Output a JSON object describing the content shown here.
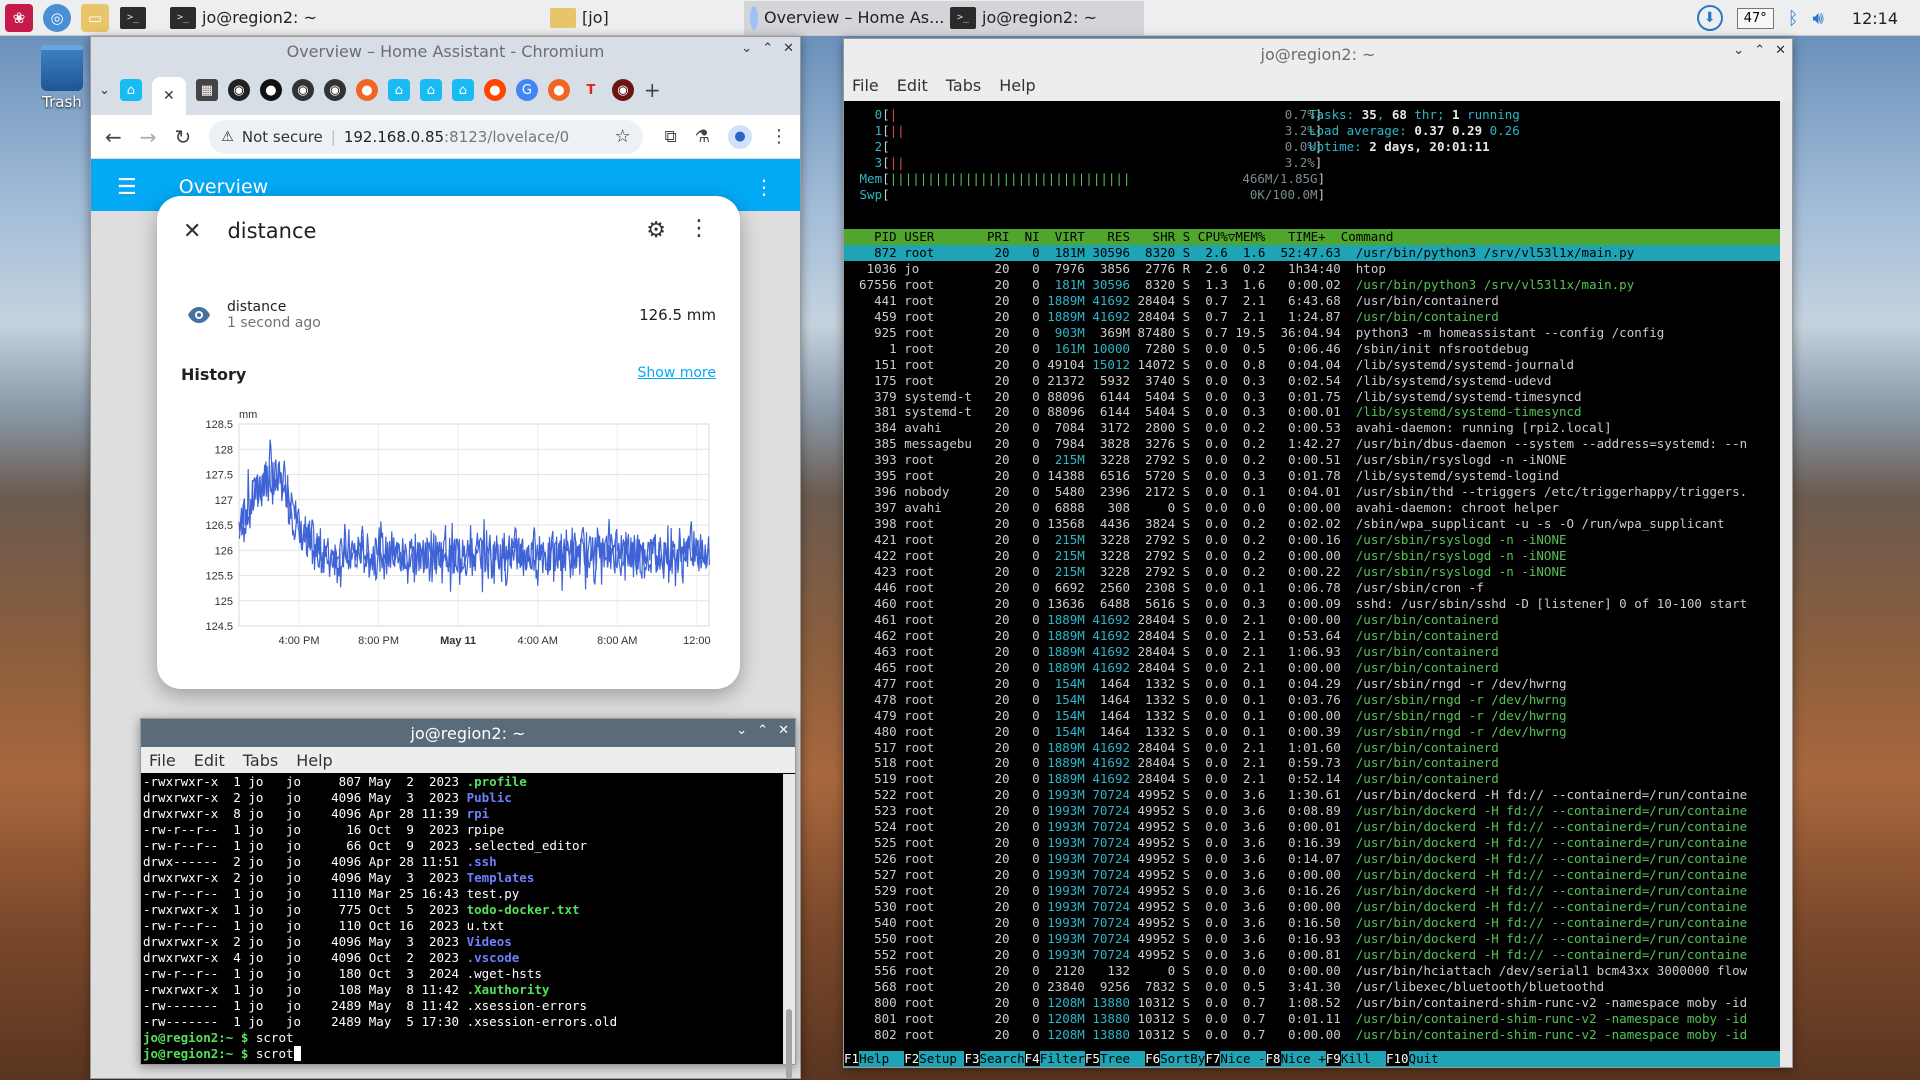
{
  "taskbar": {
    "windows": [
      {
        "label": "jo@region2: ~",
        "icon": "terminal-icon"
      },
      {
        "label": "[jo]",
        "icon": "folder-icon"
      },
      {
        "label": "Overview – Home As...",
        "icon": "chromium-icon"
      },
      {
        "label": "jo@region2: ~",
        "icon": "terminal-icon"
      }
    ],
    "temperature": "47°",
    "clock": "12:14"
  },
  "desktop": {
    "trash_label": "Trash"
  },
  "chromium": {
    "title": "Overview – Home Assistant - Chromium",
    "url_host": "192.168.0.85",
    "url_path": ":8123/lovelace/0",
    "not_secure": "Not secure"
  },
  "ha": {
    "header_title": "Overview",
    "dialog": {
      "title": "distance",
      "entity_name": "distance",
      "entity_updated": "1 second ago",
      "entity_state": "126.5 mm",
      "history_label": "History",
      "show_more": "Show more"
    }
  },
  "chart_data": {
    "type": "line",
    "title": "",
    "ylabel": "mm",
    "ylim": [
      124.5,
      128.5
    ],
    "yticks": [
      "128.5",
      "128",
      "127.5",
      "127",
      "126.5",
      "126",
      "125.5",
      "125",
      "124.5"
    ],
    "xticks": [
      "4:00 PM",
      "8:00 PM",
      "May 11",
      "4:00 AM",
      "8:00 AM",
      "12:00"
    ],
    "xtick_bold": "May 11",
    "series": [
      {
        "color": "#3f63d6",
        "values": [
          126.5,
          127.1,
          127.5,
          127.3,
          126.4,
          126.0,
          125.9,
          125.9,
          125.95,
          125.9,
          125.92,
          125.88,
          125.9,
          125.95,
          125.9,
          125.88,
          125.9,
          125.92,
          125.9,
          125.94,
          125.9,
          125.92,
          125.9,
          125.95,
          125.95,
          126.0,
          125.95,
          125.9,
          125.95,
          125.9,
          126.0,
          125.95
        ]
      }
    ]
  },
  "terminal_small": {
    "title": "jo@region2: ~",
    "menu": [
      "File",
      "Edit",
      "Tabs",
      "Help"
    ],
    "lines": [
      {
        "perm": "-rwxrwxr-x",
        "n": "1",
        "u": "jo",
        "g": "jo",
        "size": "807",
        "date": "May  2  2023",
        "name": ".profile",
        "style": "grn"
      },
      {
        "perm": "drwxrwxr-x",
        "n": "2",
        "u": "jo",
        "g": "jo",
        "size": "4096",
        "date": "May  3  2023",
        "name": "Public",
        "style": "blu"
      },
      {
        "perm": "drwxrwxr-x",
        "n": "8",
        "u": "jo",
        "g": "jo",
        "size": "4096",
        "date": "Apr 28 11:39",
        "name": "rpi",
        "style": "blu"
      },
      {
        "perm": "-rw-r--r--",
        "n": "1",
        "u": "jo",
        "g": "jo",
        "size": "16",
        "date": "Oct  9  2023",
        "name": "rpipe",
        "style": ""
      },
      {
        "perm": "-rw-r--r--",
        "n": "1",
        "u": "jo",
        "g": "jo",
        "size": "66",
        "date": "Oct  9  2023",
        "name": ".selected_editor",
        "style": ""
      },
      {
        "perm": "drwx------",
        "n": "2",
        "u": "jo",
        "g": "jo",
        "size": "4096",
        "date": "Apr 28 11:51",
        "name": ".ssh",
        "style": "blu"
      },
      {
        "perm": "drwxrwxr-x",
        "n": "2",
        "u": "jo",
        "g": "jo",
        "size": "4096",
        "date": "May  3  2023",
        "name": "Templates",
        "style": "blu"
      },
      {
        "perm": "-rw-r--r--",
        "n": "1",
        "u": "jo",
        "g": "jo",
        "size": "1110",
        "date": "Mar 25 16:43",
        "name": "test.py",
        "style": ""
      },
      {
        "perm": "-rwxrwxr-x",
        "n": "1",
        "u": "jo",
        "g": "jo",
        "size": "775",
        "date": "Oct  5  2023",
        "name": "todo-docker.txt",
        "style": "grn"
      },
      {
        "perm": "-rw-r--r--",
        "n": "1",
        "u": "jo",
        "g": "jo",
        "size": "110",
        "date": "Oct 16  2023",
        "name": "u.txt",
        "style": ""
      },
      {
        "perm": "drwxrwxr-x",
        "n": "2",
        "u": "jo",
        "g": "jo",
        "size": "4096",
        "date": "May  3  2023",
        "name": "Videos",
        "style": "blu"
      },
      {
        "perm": "drwxrwxr-x",
        "n": "4",
        "u": "jo",
        "g": "jo",
        "size": "4096",
        "date": "Oct  2  2023",
        "name": ".vscode",
        "style": "blu"
      },
      {
        "perm": "-rw-r--r--",
        "n": "1",
        "u": "jo",
        "g": "jo",
        "size": "180",
        "date": "Oct  3  2024",
        "name": ".wget-hsts",
        "style": ""
      },
      {
        "perm": "-rwxrwxr-x",
        "n": "1",
        "u": "jo",
        "g": "jo",
        "size": "108",
        "date": "May  8 11:42",
        "name": ".Xauthority",
        "style": "grn"
      },
      {
        "perm": "-rw-------",
        "n": "1",
        "u": "jo",
        "g": "jo",
        "size": "2489",
        "date": "May  8 11:42",
        "name": ".xsession-errors",
        "style": ""
      },
      {
        "perm": "-rw-------",
        "n": "1",
        "u": "jo",
        "g": "jo",
        "size": "2489",
        "date": "May  5 17:30",
        "name": ".xsession-errors.old",
        "style": ""
      }
    ],
    "prompt": "jo@region2:~ $",
    "cmd1": "scrot",
    "cmd2": "scrot"
  },
  "htop": {
    "title": "jo@region2: ~",
    "menu": [
      "File",
      "Edit",
      "Tabs",
      "Help"
    ],
    "cpu": [
      {
        "id": "0",
        "bar": "|",
        "pct": "0.7%"
      },
      {
        "id": "1",
        "bar": "||",
        "pct": "3.2%"
      },
      {
        "id": "2",
        "bar": "",
        "pct": "0.0%"
      },
      {
        "id": "3",
        "bar": "||",
        "pct": "3.2%"
      }
    ],
    "mem": {
      "bar": "||||||||||||||||||||||||||||||||",
      "val": "466M/1.85G"
    },
    "swp": {
      "val": "0K/100.0M"
    },
    "tasks": {
      "label": "Tasks:",
      "a": "35",
      "b": "68",
      "thr": "thr;",
      "c": "1",
      "running": "running"
    },
    "load": {
      "label": "Load average:",
      "a": "0.37",
      "b": "0.29",
      "c": "0.26"
    },
    "uptime": {
      "label": "Uptime:",
      "val": "2 days, 20:01:11"
    },
    "header": "    PID USER       PRI  NI  VIRT   RES   SHR S CPU%▽MEM%   TIME+  Command",
    "rows": [
      [
        "872",
        "root",
        "20",
        "0",
        "181M",
        "30596",
        "8320",
        "S",
        "2.6",
        "1.6",
        "52:47.63",
        "/usr/bin/python3 /srv/vl53l1x/main.py",
        "sel"
      ],
      [
        "1036",
        "jo",
        "20",
        "0",
        "7976",
        "3856",
        "2776",
        "R",
        "2.6",
        "0.2",
        "1h34:40",
        "htop",
        ""
      ],
      [
        "67556",
        "root",
        "20",
        "0",
        "181M",
        "30596",
        "8320",
        "S",
        "1.3",
        "1.6",
        "0:00.02",
        "/usr/bin/python3 /srv/vl53l1x/main.py",
        "g"
      ],
      [
        "441",
        "root",
        "20",
        "0",
        "1889M",
        "41692",
        "28404",
        "S",
        "0.7",
        "2.1",
        "6:43.68",
        "/usr/bin/containerd",
        ""
      ],
      [
        "459",
        "root",
        "20",
        "0",
        "1889M",
        "41692",
        "28404",
        "S",
        "0.7",
        "2.1",
        "1:24.87",
        "/usr/bin/containerd",
        "g"
      ],
      [
        "925",
        "root",
        "20",
        "0",
        "903M",
        "369M",
        "87480",
        "S",
        "0.7",
        "19.5",
        "36:04.94",
        "python3 -m homeassistant --config /config",
        ""
      ],
      [
        "1",
        "root",
        "20",
        "0",
        "161M",
        "10000",
        "7280",
        "S",
        "0.0",
        "0.5",
        "0:06.46",
        "/sbin/init nfsrootdebug",
        ""
      ],
      [
        "151",
        "root",
        "20",
        "0",
        "49104",
        "15012",
        "14072",
        "S",
        "0.0",
        "0.8",
        "0:04.04",
        "/lib/systemd/systemd-journald",
        ""
      ],
      [
        "175",
        "root",
        "20",
        "0",
        "21372",
        "5932",
        "3740",
        "S",
        "0.0",
        "0.3",
        "0:02.54",
        "/lib/systemd/systemd-udevd",
        ""
      ],
      [
        "379",
        "systemd-t",
        "20",
        "0",
        "88096",
        "6144",
        "5404",
        "S",
        "0.0",
        "0.3",
        "0:01.75",
        "/lib/systemd/systemd-timesyncd",
        ""
      ],
      [
        "381",
        "systemd-t",
        "20",
        "0",
        "88096",
        "6144",
        "5404",
        "S",
        "0.0",
        "0.3",
        "0:00.01",
        "/lib/systemd/systemd-timesyncd",
        "g"
      ],
      [
        "384",
        "avahi",
        "20",
        "0",
        "7084",
        "3172",
        "2800",
        "S",
        "0.0",
        "0.2",
        "0:00.53",
        "avahi-daemon: running [rpi2.local]",
        ""
      ],
      [
        "385",
        "messagebu",
        "20",
        "0",
        "7984",
        "3828",
        "3276",
        "S",
        "0.0",
        "0.2",
        "1:42.27",
        "/usr/bin/dbus-daemon --system --address=systemd: --n",
        ""
      ],
      [
        "393",
        "root",
        "20",
        "0",
        "215M",
        "3228",
        "2792",
        "S",
        "0.0",
        "0.2",
        "0:00.51",
        "/usr/sbin/rsyslogd -n -iNONE",
        ""
      ],
      [
        "395",
        "root",
        "20",
        "0",
        "14388",
        "6516",
        "5720",
        "S",
        "0.0",
        "0.3",
        "0:01.78",
        "/lib/systemd/systemd-logind",
        ""
      ],
      [
        "396",
        "nobody",
        "20",
        "0",
        "5480",
        "2396",
        "2172",
        "S",
        "0.0",
        "0.1",
        "0:04.01",
        "/usr/sbin/thd --triggers /etc/triggerhappy/triggers.",
        ""
      ],
      [
        "397",
        "avahi",
        "20",
        "0",
        "6888",
        "308",
        "0",
        "S",
        "0.0",
        "0.0",
        "0:00.00",
        "avahi-daemon: chroot helper",
        ""
      ],
      [
        "398",
        "root",
        "20",
        "0",
        "13568",
        "4436",
        "3824",
        "S",
        "0.0",
        "0.2",
        "0:02.02",
        "/sbin/wpa_supplicant -u -s -O /run/wpa_supplicant",
        ""
      ],
      [
        "421",
        "root",
        "20",
        "0",
        "215M",
        "3228",
        "2792",
        "S",
        "0.0",
        "0.2",
        "0:00.16",
        "/usr/sbin/rsyslogd -n -iNONE",
        "g"
      ],
      [
        "422",
        "root",
        "20",
        "0",
        "215M",
        "3228",
        "2792",
        "S",
        "0.0",
        "0.2",
        "0:00.00",
        "/usr/sbin/rsyslogd -n -iNONE",
        "g"
      ],
      [
        "423",
        "root",
        "20",
        "0",
        "215M",
        "3228",
        "2792",
        "S",
        "0.0",
        "0.2",
        "0:00.22",
        "/usr/sbin/rsyslogd -n -iNONE",
        "g"
      ],
      [
        "446",
        "root",
        "20",
        "0",
        "6692",
        "2560",
        "2308",
        "S",
        "0.0",
        "0.1",
        "0:06.78",
        "/usr/sbin/cron -f",
        ""
      ],
      [
        "460",
        "root",
        "20",
        "0",
        "13636",
        "6488",
        "5616",
        "S",
        "0.0",
        "0.3",
        "0:00.09",
        "sshd: /usr/sbin/sshd -D [listener] 0 of 10-100 start",
        ""
      ],
      [
        "461",
        "root",
        "20",
        "0",
        "1889M",
        "41692",
        "28404",
        "S",
        "0.0",
        "2.1",
        "0:00.00",
        "/usr/bin/containerd",
        "g"
      ],
      [
        "462",
        "root",
        "20",
        "0",
        "1889M",
        "41692",
        "28404",
        "S",
        "0.0",
        "2.1",
        "0:53.64",
        "/usr/bin/containerd",
        "g"
      ],
      [
        "463",
        "root",
        "20",
        "0",
        "1889M",
        "41692",
        "28404",
        "S",
        "0.0",
        "2.1",
        "1:06.93",
        "/usr/bin/containerd",
        "g"
      ],
      [
        "465",
        "root",
        "20",
        "0",
        "1889M",
        "41692",
        "28404",
        "S",
        "0.0",
        "2.1",
        "0:00.00",
        "/usr/bin/containerd",
        "g"
      ],
      [
        "477",
        "root",
        "20",
        "0",
        "154M",
        "1464",
        "1332",
        "S",
        "0.0",
        "0.1",
        "0:04.29",
        "/usr/sbin/rngd -r /dev/hwrng",
        ""
      ],
      [
        "478",
        "root",
        "20",
        "0",
        "154M",
        "1464",
        "1332",
        "S",
        "0.0",
        "0.1",
        "0:03.76",
        "/usr/sbin/rngd -r /dev/hwrng",
        "g"
      ],
      [
        "479",
        "root",
        "20",
        "0",
        "154M",
        "1464",
        "1332",
        "S",
        "0.0",
        "0.1",
        "0:00.00",
        "/usr/sbin/rngd -r /dev/hwrng",
        "g"
      ],
      [
        "480",
        "root",
        "20",
        "0",
        "154M",
        "1464",
        "1332",
        "S",
        "0.0",
        "0.1",
        "0:00.39",
        "/usr/sbin/rngd -r /dev/hwrng",
        "g"
      ],
      [
        "517",
        "root",
        "20",
        "0",
        "1889M",
        "41692",
        "28404",
        "S",
        "0.0",
        "2.1",
        "1:01.60",
        "/usr/bin/containerd",
        "g"
      ],
      [
        "518",
        "root",
        "20",
        "0",
        "1889M",
        "41692",
        "28404",
        "S",
        "0.0",
        "2.1",
        "0:59.73",
        "/usr/bin/containerd",
        "g"
      ],
      [
        "519",
        "root",
        "20",
        "0",
        "1889M",
        "41692",
        "28404",
        "S",
        "0.0",
        "2.1",
        "0:52.14",
        "/usr/bin/containerd",
        "g"
      ],
      [
        "522",
        "root",
        "20",
        "0",
        "1993M",
        "70724",
        "49952",
        "S",
        "0.0",
        "3.6",
        "1:30.61",
        "/usr/bin/dockerd -H fd:// --containerd=/run/containe",
        ""
      ],
      [
        "523",
        "root",
        "20",
        "0",
        "1993M",
        "70724",
        "49952",
        "S",
        "0.0",
        "3.6",
        "0:08.89",
        "/usr/bin/dockerd -H fd:// --containerd=/run/containe",
        "g"
      ],
      [
        "524",
        "root",
        "20",
        "0",
        "1993M",
        "70724",
        "49952",
        "S",
        "0.0",
        "3.6",
        "0:00.01",
        "/usr/bin/dockerd -H fd:// --containerd=/run/containe",
        "g"
      ],
      [
        "525",
        "root",
        "20",
        "0",
        "1993M",
        "70724",
        "49952",
        "S",
        "0.0",
        "3.6",
        "0:16.39",
        "/usr/bin/dockerd -H fd:// --containerd=/run/containe",
        "g"
      ],
      [
        "526",
        "root",
        "20",
        "0",
        "1993M",
        "70724",
        "49952",
        "S",
        "0.0",
        "3.6",
        "0:14.07",
        "/usr/bin/dockerd -H fd:// --containerd=/run/containe",
        "g"
      ],
      [
        "527",
        "root",
        "20",
        "0",
        "1993M",
        "70724",
        "49952",
        "S",
        "0.0",
        "3.6",
        "0:00.00",
        "/usr/bin/dockerd -H fd:// --containerd=/run/containe",
        "g"
      ],
      [
        "529",
        "root",
        "20",
        "0",
        "1993M",
        "70724",
        "49952",
        "S",
        "0.0",
        "3.6",
        "0:16.26",
        "/usr/bin/dockerd -H fd:// --containerd=/run/containe",
        "g"
      ],
      [
        "530",
        "root",
        "20",
        "0",
        "1993M",
        "70724",
        "49952",
        "S",
        "0.0",
        "3.6",
        "0:00.00",
        "/usr/bin/dockerd -H fd:// --containerd=/run/containe",
        "g"
      ],
      [
        "540",
        "root",
        "20",
        "0",
        "1993M",
        "70724",
        "49952",
        "S",
        "0.0",
        "3.6",
        "0:16.50",
        "/usr/bin/dockerd -H fd:// --containerd=/run/containe",
        "g"
      ],
      [
        "550",
        "root",
        "20",
        "0",
        "1993M",
        "70724",
        "49952",
        "S",
        "0.0",
        "3.6",
        "0:16.93",
        "/usr/bin/dockerd -H fd:// --containerd=/run/containe",
        "g"
      ],
      [
        "552",
        "root",
        "20",
        "0",
        "1993M",
        "70724",
        "49952",
        "S",
        "0.0",
        "3.6",
        "0:00.81",
        "/usr/bin/dockerd -H fd:// --containerd=/run/containe",
        "g"
      ],
      [
        "556",
        "root",
        "20",
        "0",
        "2120",
        "132",
        "0",
        "S",
        "0.0",
        "0.0",
        "0:00.00",
        "/usr/bin/hciattach /dev/serial1 bcm43xx 3000000 flow",
        ""
      ],
      [
        "568",
        "root",
        "20",
        "0",
        "23840",
        "9256",
        "7832",
        "S",
        "0.0",
        "0.5",
        "3:41.30",
        "/usr/libexec/bluetooth/bluetoothd",
        ""
      ],
      [
        "800",
        "root",
        "20",
        "0",
        "1208M",
        "13880",
        "10312",
        "S",
        "0.0",
        "0.7",
        "1:08.52",
        "/usr/bin/containerd-shim-runc-v2 -namespace moby -id",
        ""
      ],
      [
        "801",
        "root",
        "20",
        "0",
        "1208M",
        "13880",
        "10312",
        "S",
        "0.0",
        "0.7",
        "0:01.11",
        "/usr/bin/containerd-shim-runc-v2 -namespace moby -id",
        "g"
      ],
      [
        "802",
        "root",
        "20",
        "0",
        "1208M",
        "13880",
        "10312",
        "S",
        "0.0",
        "0.7",
        "0:00.00",
        "/usr/bin/containerd-shim-runc-v2 -namespace moby -id",
        "g"
      ]
    ],
    "fkeys": [
      [
        "F1",
        "Help"
      ],
      [
        "F2",
        "Setup"
      ],
      [
        "F3",
        "Search"
      ],
      [
        "F4",
        "Filter"
      ],
      [
        "F5",
        "Tree"
      ],
      [
        "F6",
        "SortBy"
      ],
      [
        "F7",
        "Nice -"
      ],
      [
        "F8",
        "Nice +"
      ],
      [
        "F9",
        "Kill"
      ],
      [
        "F10",
        "Quit"
      ]
    ]
  }
}
